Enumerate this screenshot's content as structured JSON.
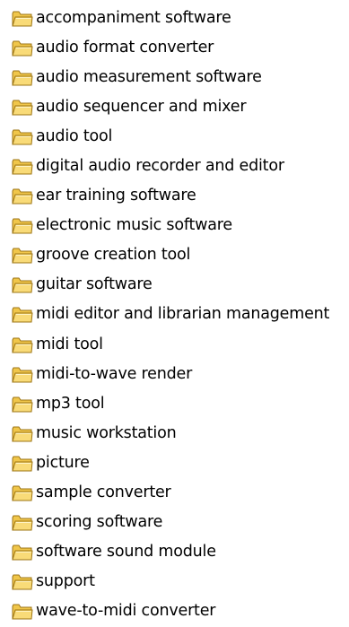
{
  "folder_view": {
    "icon": "folder-icon",
    "icon_colors": {
      "body": "#f0c64a",
      "front": "#f9db78",
      "outline": "#9c7414"
    },
    "items": [
      {
        "label": "accompaniment software"
      },
      {
        "label": "audio format converter"
      },
      {
        "label": "audio measurement software"
      },
      {
        "label": "audio sequencer and mixer"
      },
      {
        "label": "audio tool"
      },
      {
        "label": "digital audio recorder and editor"
      },
      {
        "label": "ear training software"
      },
      {
        "label": "electronic music software"
      },
      {
        "label": "groove creation tool"
      },
      {
        "label": "guitar software"
      },
      {
        "label": "midi editor and librarian management"
      },
      {
        "label": "midi tool"
      },
      {
        "label": "midi-to-wave render"
      },
      {
        "label": "mp3 tool"
      },
      {
        "label": "music workstation"
      },
      {
        "label": "picture"
      },
      {
        "label": "sample converter"
      },
      {
        "label": "scoring software"
      },
      {
        "label": "software sound module"
      },
      {
        "label": "support"
      },
      {
        "label": "wave-to-midi converter"
      }
    ]
  }
}
